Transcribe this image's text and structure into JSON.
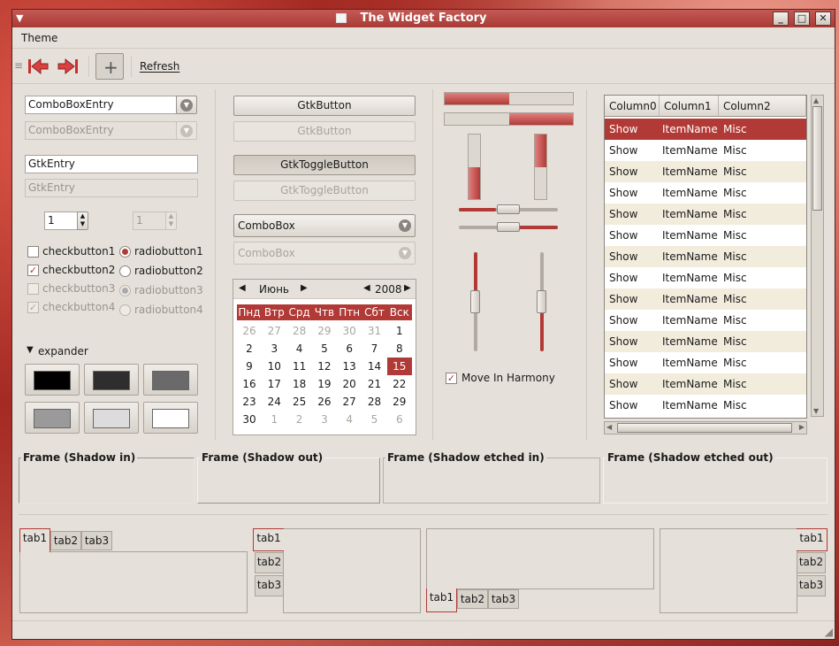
{
  "window": {
    "title": "The Widget Factory"
  },
  "menu": {
    "theme": "Theme"
  },
  "toolbar": {
    "refresh": "Refresh"
  },
  "col1": {
    "combo_entry": "ComboBoxEntry",
    "combo_entry_dis": "ComboBoxEntry",
    "entry": "GtkEntry",
    "entry_dis": "GtkEntry",
    "spin": "1",
    "spin_dis": "1",
    "check1": "checkbutton1",
    "check2": "checkbutton2",
    "check3": "checkbutton3",
    "check4": "checkbutton4",
    "radio1": "radiobutton1",
    "radio2": "radiobutton2",
    "radio3": "radiobutton3",
    "radio4": "radiobutton4",
    "expander": "expander",
    "swatch_colors": [
      "#000000",
      "#2e2e2e",
      "#6a6a6a",
      "#9a9a9a",
      "#dcdcdc",
      "#ffffff"
    ]
  },
  "col2": {
    "button": "GtkButton",
    "button_dis": "GtkButton",
    "toggle": "GtkToggleButton",
    "toggle_dis": "GtkToggleButton",
    "combo": "ComboBox",
    "combo_dis": "ComboBox"
  },
  "calendar": {
    "month": "Июнь",
    "year": "2008",
    "weekdays": [
      "Пнд",
      "Втр",
      "Срд",
      "Чтв",
      "Птн",
      "Сбт",
      "Вск"
    ],
    "weeks": [
      [
        "26",
        "27",
        "28",
        "29",
        "30",
        "31",
        "1"
      ],
      [
        "2",
        "3",
        "4",
        "5",
        "6",
        "7",
        "8"
      ],
      [
        "9",
        "10",
        "11",
        "12",
        "13",
        "14",
        "15"
      ],
      [
        "16",
        "17",
        "18",
        "19",
        "20",
        "21",
        "22"
      ],
      [
        "23",
        "24",
        "25",
        "26",
        "27",
        "28",
        "29"
      ],
      [
        "30",
        "1",
        "2",
        "3",
        "4",
        "5",
        "6"
      ]
    ],
    "selected": "15"
  },
  "col3": {
    "progress_h": [
      0.5,
      0.5
    ],
    "progress_v": [
      0.5,
      0.5
    ],
    "harmony": "Move In Harmony"
  },
  "tree": {
    "columns": [
      "Column0",
      "Column1",
      "Column2"
    ],
    "rows": [
      [
        "Show",
        "ItemName",
        "Misc"
      ],
      [
        "Show",
        "ItemName",
        "Misc"
      ],
      [
        "Show",
        "ItemName",
        "Misc"
      ],
      [
        "Show",
        "ItemName",
        "Misc"
      ],
      [
        "Show",
        "ItemName",
        "Misc"
      ],
      [
        "Show",
        "ItemName",
        "Misc"
      ],
      [
        "Show",
        "ItemName",
        "Misc"
      ],
      [
        "Show",
        "ItemName",
        "Misc"
      ],
      [
        "Show",
        "ItemName",
        "Misc"
      ],
      [
        "Show",
        "ItemName",
        "Misc"
      ],
      [
        "Show",
        "ItemName",
        "Misc"
      ],
      [
        "Show",
        "ItemName",
        "Misc"
      ],
      [
        "Show",
        "ItemName",
        "Misc"
      ],
      [
        "Show",
        "ItemName",
        "Misc"
      ]
    ]
  },
  "frames": [
    "Frame (Shadow in)",
    "Frame (Shadow out)",
    "Frame (Shadow etched in)",
    "Frame (Shadow etched out)"
  ],
  "tabs": [
    "tab1",
    "tab2",
    "tab3"
  ]
}
